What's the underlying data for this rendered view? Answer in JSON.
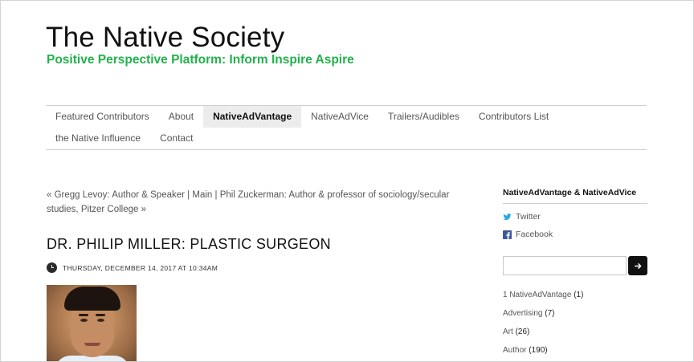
{
  "header": {
    "title": "The Native Society",
    "tagline": "Positive Perspective Platform: Inform Inspire Aspire"
  },
  "nav": {
    "row1": [
      {
        "label": "Featured Contributors"
      },
      {
        "label": "About"
      },
      {
        "label": "NativeAdVantage",
        "active": true
      },
      {
        "label": "NativeAdVice"
      },
      {
        "label": "Trailers/Audibles"
      },
      {
        "label": "Contributors List"
      }
    ],
    "row2": [
      {
        "label": "the Native Influence"
      },
      {
        "label": "Contact"
      }
    ]
  },
  "post_nav": {
    "prev": "« Gregg Levoy: Author & Speaker",
    "sep1": " | ",
    "main": "Main",
    "sep2": " | ",
    "next": "Phil Zuckerman: Author & professor of sociology/secular studies, Pitzer College »"
  },
  "post": {
    "title": "DR. PHILIP MILLER: PLASTIC SURGEON",
    "date": "THURSDAY, DECEMBER 14, 2017 AT 10:34AM",
    "date_icon": "clock-icon"
  },
  "sidebar": {
    "heading": "NativeAdVantage & NativeAdVice",
    "social": {
      "twitter_label": "Twitter",
      "facebook_label": "Facebook"
    },
    "search": {
      "value": "",
      "button_icon": "arrow-right-icon"
    },
    "categories": [
      {
        "name": "1 NativeAdVantage",
        "count": "(1)"
      },
      {
        "name": "Advertising",
        "count": "(7)"
      },
      {
        "name": "Art",
        "count": "(26)"
      },
      {
        "name": "Author",
        "count": "(190)"
      }
    ]
  },
  "colors": {
    "tagline": "#22b14c",
    "nav_active_bg": "#ececec",
    "facebook": "#3b5998",
    "twitter": "#2aa9e0"
  }
}
